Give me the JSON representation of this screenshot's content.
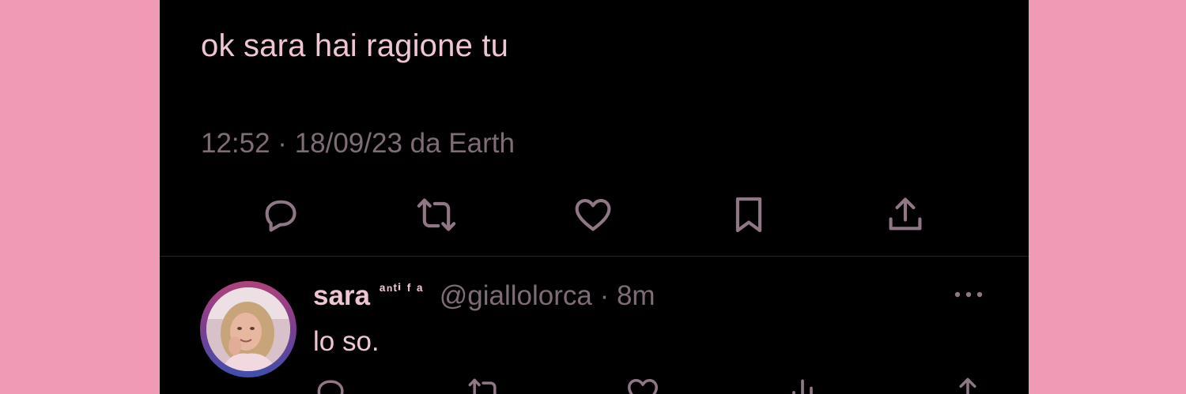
{
  "tweet": {
    "text": "ok sara hai ragione tu",
    "meta": "12:52 · 18/09/23 da Earth"
  },
  "actions": [
    {
      "icon": "reply-icon",
      "label": "Reply"
    },
    {
      "icon": "retweet-icon",
      "label": "Retweet"
    },
    {
      "icon": "like-icon",
      "label": "Like"
    },
    {
      "icon": "bookmark-icon",
      "label": "Bookmark"
    },
    {
      "icon": "share-icon",
      "label": "Share"
    }
  ],
  "reply": {
    "name": "sara",
    "badge": "ᵃⁿᵗⁱ ᶠ ᵃ",
    "handle": "@giallolorca · 8m",
    "text": "lo so.",
    "more_icon": "more-icon"
  },
  "colors": {
    "frame": "#f09bb6",
    "screen": "#000000",
    "text": "#eec6d3",
    "muted": "#7e6c76",
    "icon": "#8f7785"
  }
}
